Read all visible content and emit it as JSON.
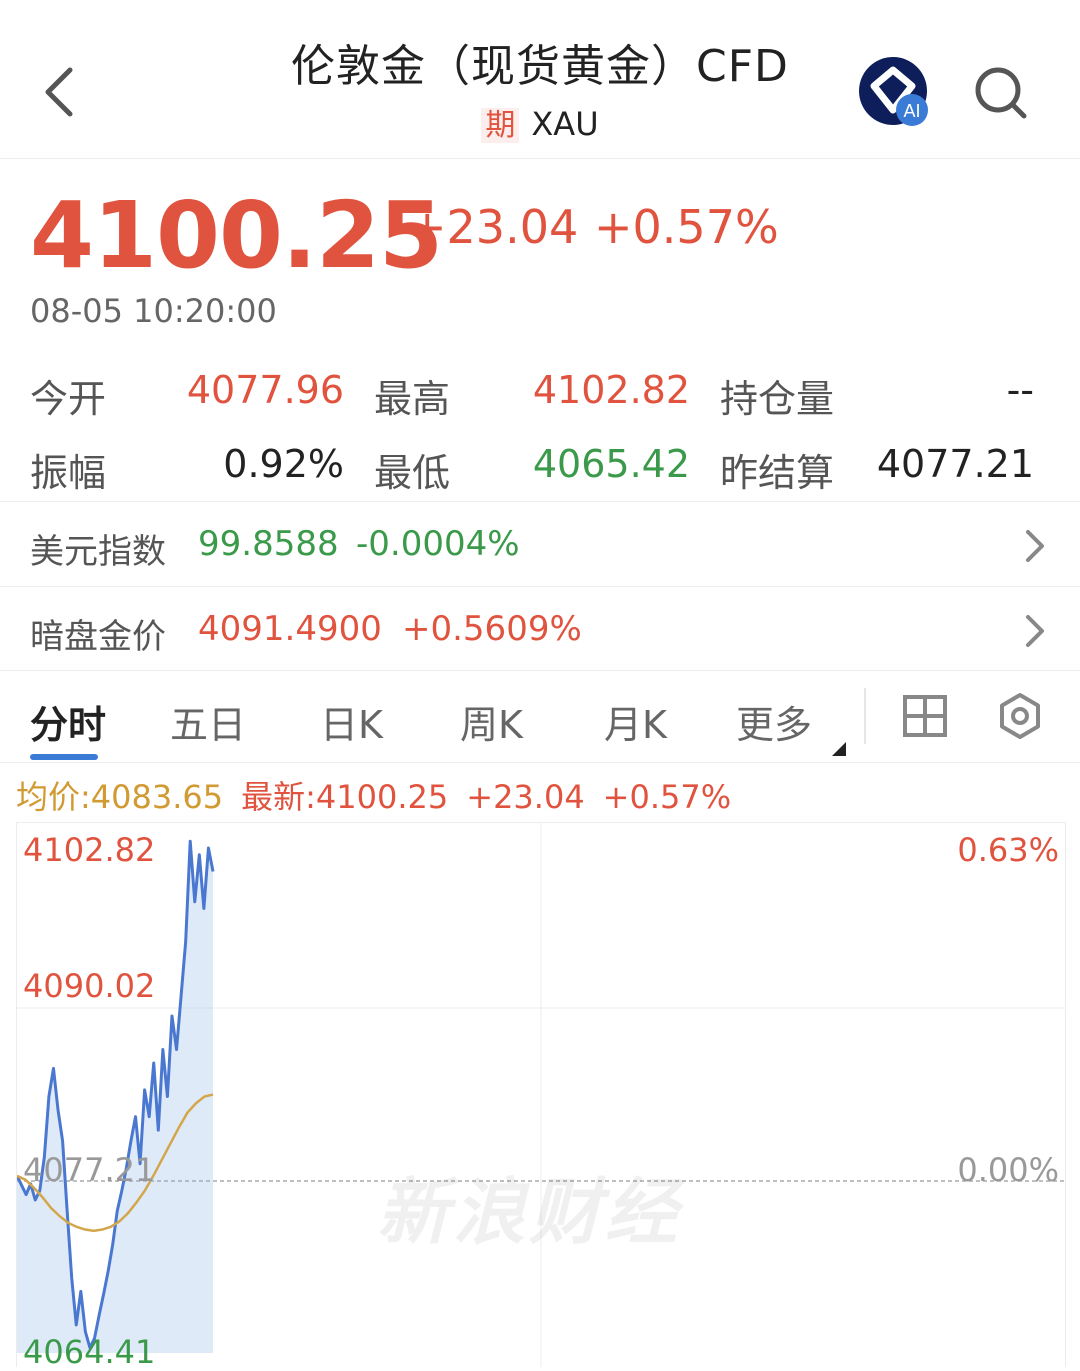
{
  "header": {
    "title": "伦敦金（现货黄金）CFD",
    "tag": "期",
    "symbol": "XAU",
    "ai_badge": "AI"
  },
  "quote": {
    "price": "4100.25",
    "change": "+23.04",
    "change_pct": "+0.57%",
    "timestamp": "08-05 10:20:00"
  },
  "stats": {
    "open_label": "今开",
    "open": "4077.96",
    "high_label": "最高",
    "high": "4102.82",
    "oi_label": "持仓量",
    "oi": "--",
    "amp_label": "振幅",
    "amp": "0.92%",
    "low_label": "最低",
    "low": "4065.42",
    "settle_label": "昨结算",
    "settle": "4077.21"
  },
  "info_rows": [
    {
      "label": "美元指数",
      "value": "99.8588",
      "pct": "-0.0004%"
    },
    {
      "label": "暗盘金价",
      "value": "4091.4900",
      "pct": "+0.5609%"
    }
  ],
  "tabs": [
    "分时",
    "五日",
    "日K",
    "周K",
    "月K",
    "更多"
  ],
  "legend": {
    "avg": "均价:4083.65",
    "latest": "最新:4100.25",
    "change": "+23.04",
    "pct": "+0.57%"
  },
  "chart_data": {
    "type": "line",
    "y_labels_left": [
      "4102.82",
      "4090.02",
      "4077.21",
      "4064.41"
    ],
    "y_labels_right": [
      "0.63%",
      "0.00%"
    ],
    "ylim": [
      4064.41,
      4102.82
    ],
    "reference": 4077.21,
    "series": [
      {
        "values": [
          4077.6,
          4076.9,
          4076.2,
          4077.0,
          4075.8,
          4076.5,
          4079.0,
          4083.5,
          4085.6,
          4082.5,
          4080.2,
          4075.0,
          4070.0,
          4066.5,
          4069.0,
          4066.0,
          4064.8,
          4065.5,
          4067.2,
          4068.8,
          4070.5,
          4072.5,
          4075.0,
          4076.5,
          4078.2,
          4080.2,
          4082.0,
          4078.5,
          4084.0,
          4082.0,
          4086.0,
          4081.0,
          4087.0,
          4083.5,
          4089.5,
          4087.0,
          4091.0,
          4095.0,
          4102.5,
          4098.0,
          4101.5,
          4097.5,
          4102.0,
          4100.25
        ]
      },
      {
        "values": [
          4077.6,
          4077.3,
          4076.7,
          4076.0,
          4075.2,
          4074.6,
          4074.1,
          4073.8,
          4073.6,
          4073.5,
          4073.6,
          4073.8,
          4074.2,
          4074.8,
          4075.6,
          4076.5,
          4077.6,
          4078.8,
          4080.0,
          4081.2,
          4082.3,
          4083.0,
          4083.5,
          4083.65
        ]
      }
    ]
  },
  "watermark": "新浪财经"
}
